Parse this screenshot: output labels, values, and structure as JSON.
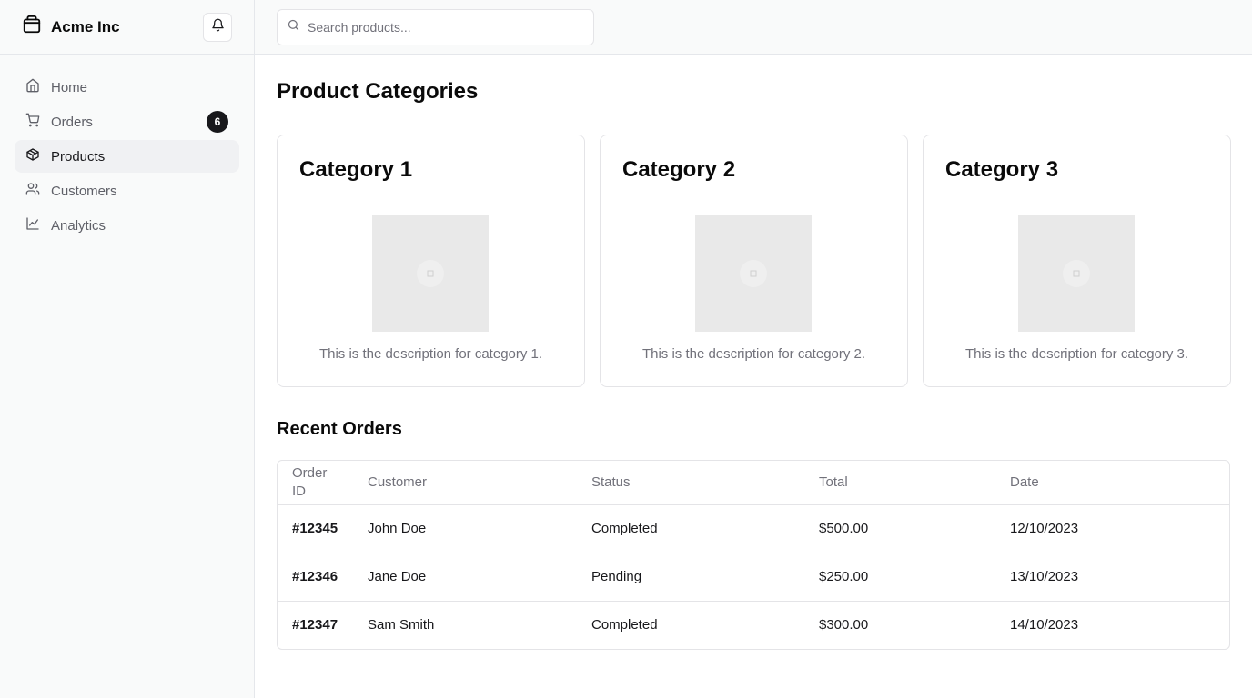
{
  "brand": {
    "name": "Acme Inc",
    "icon": "package-icon"
  },
  "sidebar": {
    "items": [
      {
        "label": "Home",
        "icon": "home-icon",
        "active": false
      },
      {
        "label": "Orders",
        "icon": "cart-icon",
        "active": false,
        "badge": "6"
      },
      {
        "label": "Products",
        "icon": "box-icon",
        "active": true
      },
      {
        "label": "Customers",
        "icon": "users-icon",
        "active": false
      },
      {
        "label": "Analytics",
        "icon": "chart-line-icon",
        "active": false
      }
    ]
  },
  "search": {
    "placeholder": "Search products...",
    "value": ""
  },
  "page": {
    "title": "Product Categories"
  },
  "categories": [
    {
      "title": "Category 1",
      "description": "This is the description for category 1."
    },
    {
      "title": "Category 2",
      "description": "This is the description for category 2."
    },
    {
      "title": "Category 3",
      "description": "This is the description for category 3."
    }
  ],
  "orders": {
    "title": "Recent Orders",
    "columns": [
      "Order ID",
      "Customer",
      "Status",
      "Total",
      "Date"
    ],
    "rows": [
      {
        "id": "#12345",
        "customer": "John Doe",
        "status": "Completed",
        "total": "$500.00",
        "date": "12/10/2023"
      },
      {
        "id": "#12346",
        "customer": "Jane Doe",
        "status": "Pending",
        "total": "$250.00",
        "date": "13/10/2023"
      },
      {
        "id": "#12347",
        "customer": "Sam Smith",
        "status": "Completed",
        "total": "$300.00",
        "date": "14/10/2023"
      }
    ]
  },
  "colors": {
    "accent": "#18181b",
    "muted_text": "#71717a",
    "border": "#e4e4e7",
    "sidebar_bg": "#f9fafa"
  }
}
